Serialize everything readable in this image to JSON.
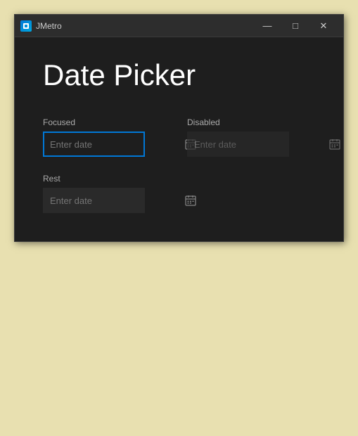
{
  "window": {
    "title": "JMetro"
  },
  "titlebar": {
    "minimize_label": "—",
    "maximize_label": "□",
    "close_label": "✕"
  },
  "page": {
    "title": "Date Picker"
  },
  "pickers": {
    "focused_label": "Focused",
    "focused_placeholder": "Enter date",
    "disabled_label": "Disabled",
    "disabled_placeholder": "Enter date",
    "rest_label": "Rest",
    "rest_placeholder": "Enter date"
  }
}
